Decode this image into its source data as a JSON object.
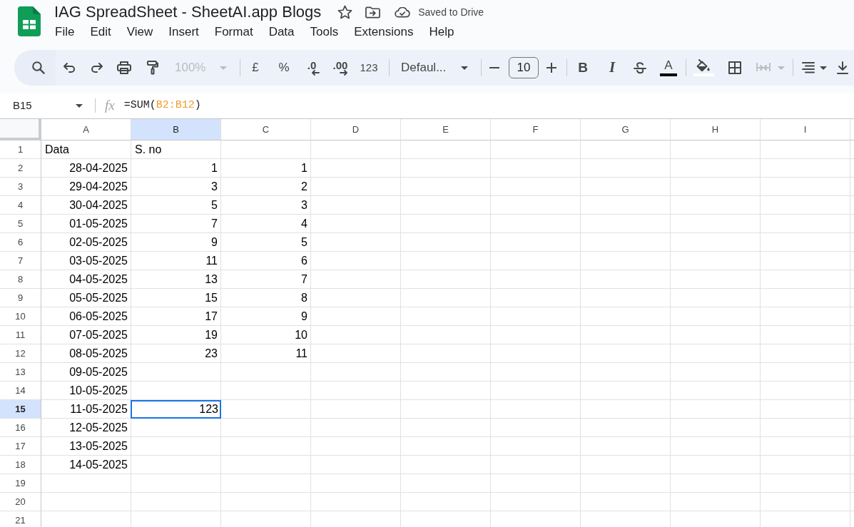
{
  "header": {
    "title": "IAG SpreadSheet - SheetAI.app Blogs",
    "save_status": "Saved to Drive",
    "menu": [
      "File",
      "Edit",
      "View",
      "Insert",
      "Format",
      "Data",
      "Tools",
      "Extensions",
      "Help"
    ]
  },
  "toolbar": {
    "zoom": {
      "value": "100%",
      "disabled": true
    },
    "currency": "£",
    "percent": "%",
    "decrease_decimals": ".0",
    "increase_decimals": ".00",
    "number_format": "123",
    "font": "Defaul...",
    "font_size": "10",
    "bold": "B",
    "italic": "I",
    "text_color": {
      "label": "A",
      "color": "#000000"
    },
    "fill_color": {
      "color": "#ffffff"
    },
    "merge": {
      "disabled": true
    }
  },
  "formula_bar": {
    "name_box": "B15",
    "function_label": "fx",
    "formula": [
      {
        "text": "=SUM(",
        "kind": "plain"
      },
      {
        "text": "B2:B12",
        "kind": "range"
      },
      {
        "text": ")",
        "kind": "plain"
      }
    ]
  },
  "grid": {
    "columns": [
      {
        "label": "A",
        "selected": false
      },
      {
        "label": "B",
        "selected": true
      },
      {
        "label": "C",
        "selected": false
      },
      {
        "label": "D",
        "selected": false
      },
      {
        "label": "E",
        "selected": false
      },
      {
        "label": "F",
        "selected": false
      },
      {
        "label": "G",
        "selected": false
      },
      {
        "label": "H",
        "selected": false
      },
      {
        "label": "I",
        "selected": false
      }
    ],
    "rows": [
      {
        "number": "1",
        "selected": false,
        "cells": [
          {
            "text": "Data",
            "kind": "text"
          },
          {
            "text": "S. no",
            "kind": "text"
          }
        ]
      },
      {
        "number": "2",
        "selected": false,
        "cells": [
          {
            "text": "28-04-2025",
            "kind": "number"
          },
          {
            "text": "1",
            "kind": "number"
          },
          {
            "text": "1",
            "kind": "number"
          }
        ]
      },
      {
        "number": "3",
        "selected": false,
        "cells": [
          {
            "text": "29-04-2025",
            "kind": "number"
          },
          {
            "text": "3",
            "kind": "number"
          },
          {
            "text": "2",
            "kind": "number"
          }
        ]
      },
      {
        "number": "4",
        "selected": false,
        "cells": [
          {
            "text": "30-04-2025",
            "kind": "number"
          },
          {
            "text": "5",
            "kind": "number"
          },
          {
            "text": "3",
            "kind": "number"
          }
        ]
      },
      {
        "number": "5",
        "selected": false,
        "cells": [
          {
            "text": "01-05-2025",
            "kind": "number"
          },
          {
            "text": "7",
            "kind": "number"
          },
          {
            "text": "4",
            "kind": "number"
          }
        ]
      },
      {
        "number": "6",
        "selected": false,
        "cells": [
          {
            "text": "02-05-2025",
            "kind": "number"
          },
          {
            "text": "9",
            "kind": "number"
          },
          {
            "text": "5",
            "kind": "number"
          }
        ]
      },
      {
        "number": "7",
        "selected": false,
        "cells": [
          {
            "text": "03-05-2025",
            "kind": "number"
          },
          {
            "text": "11",
            "kind": "number"
          },
          {
            "text": "6",
            "kind": "number"
          }
        ]
      },
      {
        "number": "8",
        "selected": false,
        "cells": [
          {
            "text": "04-05-2025",
            "kind": "number"
          },
          {
            "text": "13",
            "kind": "number"
          },
          {
            "text": "7",
            "kind": "number"
          }
        ]
      },
      {
        "number": "9",
        "selected": false,
        "cells": [
          {
            "text": "05-05-2025",
            "kind": "number"
          },
          {
            "text": "15",
            "kind": "number"
          },
          {
            "text": "8",
            "kind": "number"
          }
        ]
      },
      {
        "number": "10",
        "selected": false,
        "cells": [
          {
            "text": "06-05-2025",
            "kind": "number"
          },
          {
            "text": "17",
            "kind": "number"
          },
          {
            "text": "9",
            "kind": "number"
          }
        ]
      },
      {
        "number": "11",
        "selected": false,
        "cells": [
          {
            "text": "07-05-2025",
            "kind": "number"
          },
          {
            "text": "19",
            "kind": "number"
          },
          {
            "text": "10",
            "kind": "number"
          }
        ]
      },
      {
        "number": "12",
        "selected": false,
        "cells": [
          {
            "text": "08-05-2025",
            "kind": "number"
          },
          {
            "text": "23",
            "kind": "number"
          },
          {
            "text": "11",
            "kind": "number"
          }
        ]
      },
      {
        "number": "13",
        "selected": false,
        "cells": [
          {
            "text": "09-05-2025",
            "kind": "number"
          }
        ]
      },
      {
        "number": "14",
        "selected": false,
        "cells": [
          {
            "text": "10-05-2025",
            "kind": "number"
          }
        ]
      },
      {
        "number": "15",
        "selected": true,
        "cells": [
          {
            "text": "11-05-2025",
            "kind": "number"
          },
          {
            "text": "123",
            "kind": "number"
          }
        ]
      },
      {
        "number": "16",
        "selected": false,
        "cells": [
          {
            "text": "12-05-2025",
            "kind": "number"
          }
        ]
      },
      {
        "number": "17",
        "selected": false,
        "cells": [
          {
            "text": "13-05-2025",
            "kind": "number"
          }
        ]
      },
      {
        "number": "18",
        "selected": false,
        "cells": [
          {
            "text": "14-05-2025",
            "kind": "number"
          }
        ]
      },
      {
        "number": "19",
        "selected": false
      },
      {
        "number": "20",
        "selected": false
      },
      {
        "number": "21",
        "selected": false
      }
    ]
  }
}
